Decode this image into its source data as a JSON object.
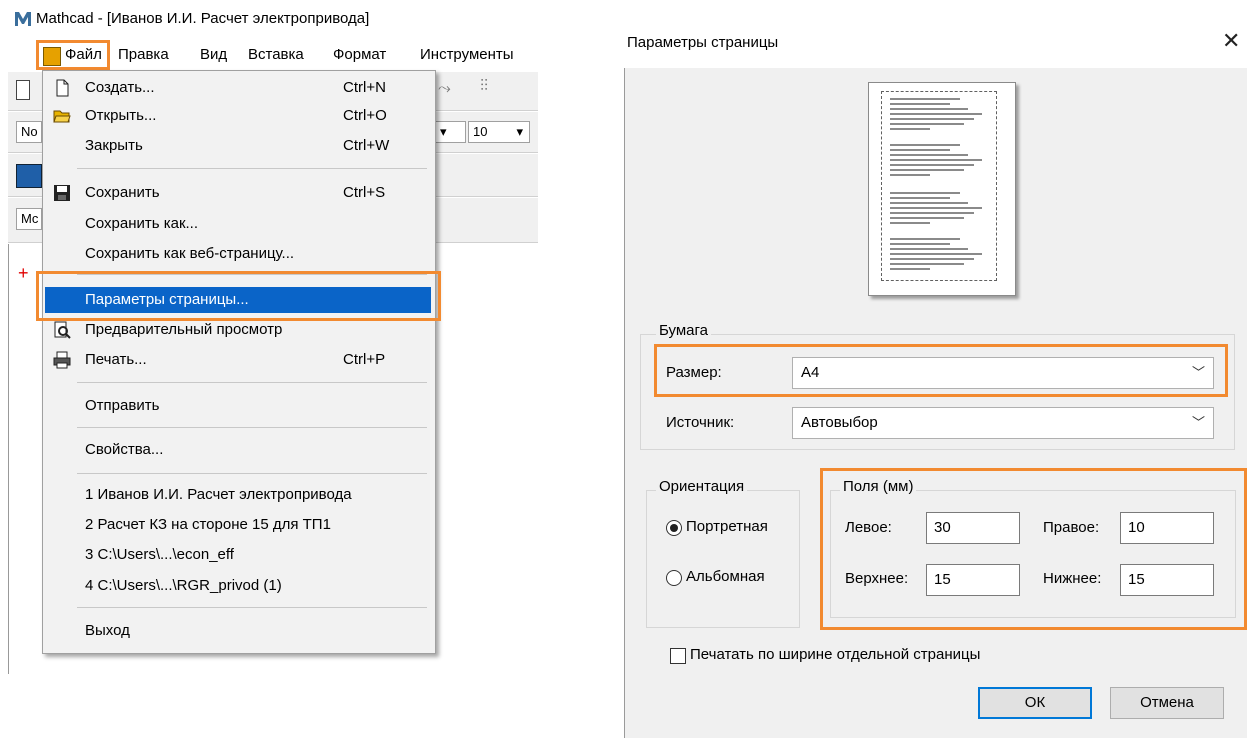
{
  "app": {
    "title": "Mathcad - [Иванов И.И. Расчет электропривода]",
    "logo_icon": "mathcad-logo-icon",
    "menubar": [
      "Файл",
      "Правка",
      "Вид",
      "Вставка",
      "Формат",
      "Инструменты"
    ],
    "toolbar": {
      "font_name_fragment": "No",
      "font_size": "10",
      "style_fragment": "Mc"
    }
  },
  "file_menu": {
    "items": [
      {
        "label": "Создать...",
        "shortcut": "Ctrl+N",
        "icon": "new-document-icon"
      },
      {
        "label": "Открыть...",
        "shortcut": "Ctrl+O",
        "icon": "open-folder-icon"
      },
      {
        "label": "Закрыть",
        "shortcut": "Ctrl+W",
        "icon": ""
      },
      {
        "label": "Сохранить",
        "shortcut": "Ctrl+S",
        "icon": "save-disk-icon"
      },
      {
        "label": "Сохранить как...",
        "shortcut": "",
        "icon": ""
      },
      {
        "label": "Сохранить как веб-страницу...",
        "shortcut": "",
        "icon": ""
      },
      {
        "label": "Параметры страницы...",
        "shortcut": "",
        "icon": ""
      },
      {
        "label": "Предварительный просмотр",
        "shortcut": "",
        "icon": "print-preview-icon"
      },
      {
        "label": "Печать...",
        "shortcut": "Ctrl+P",
        "icon": "printer-icon"
      },
      {
        "label": "Отправить",
        "shortcut": "",
        "icon": ""
      },
      {
        "label": "Свойства...",
        "shortcut": "",
        "icon": ""
      },
      {
        "label": "1 Иванов И.И. Расчет электропривода",
        "shortcut": "",
        "icon": ""
      },
      {
        "label": "2 Расчет КЗ на стороне 15 для ТП1",
        "shortcut": "",
        "icon": ""
      },
      {
        "label": "3 C:\\Users\\...\\econ_eff",
        "shortcut": "",
        "icon": ""
      },
      {
        "label": "4 C:\\Users\\...\\RGR_privod (1)",
        "shortcut": "",
        "icon": ""
      },
      {
        "label": "Выход",
        "shortcut": "",
        "icon": ""
      }
    ],
    "selected": "Параметры страницы..."
  },
  "dialog": {
    "title": "Параметры страницы",
    "paper_group": "Бумага",
    "size_label": "Размер:",
    "size_value": "A4",
    "source_label": "Источник:",
    "source_value": "Автовыбор",
    "orientation_group": "Ориентация",
    "portrait_label": "Портретная",
    "landscape_label": "Альбомная",
    "orientation_selected": "Портретная",
    "margins_group": "Поля (мм)",
    "left_label": "Левое:",
    "left_value": "30",
    "right_label": "Правое:",
    "right_value": "10",
    "top_label": "Верхнее:",
    "top_value": "15",
    "bottom_label": "Нижнее:",
    "bottom_value": "15",
    "fit_width_label": "Печатать по ширине отдельной страницы",
    "fit_width_checked": false,
    "ok_label": "ОК",
    "cancel_label": "Отмена"
  },
  "colors": {
    "highlight": "#f28a30",
    "menu_selection": "#0a64c8",
    "default_button_border": "#0078d7"
  }
}
